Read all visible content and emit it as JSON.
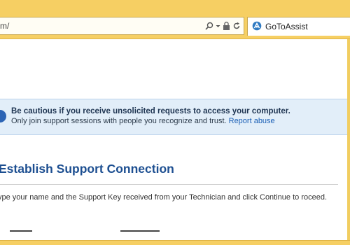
{
  "browser": {
    "address_text": "m/",
    "tab_title": "GoToAssist",
    "colors": {
      "chrome": "#f6cf63",
      "accent": "#1d4f91",
      "link": "#1b5fb5"
    },
    "icons": [
      "search-icon",
      "dropdown-arrow-icon",
      "lock-icon",
      "refresh-icon",
      "gotoassist-logo-icon"
    ]
  },
  "warning": {
    "title": "Be cautious if you receive unsolicited requests to access your computer.",
    "body": "Only join support sessions with people you recognize and trust.",
    "link_label": "Report abuse",
    "icon": "info-icon"
  },
  "main": {
    "heading": "Establish Support Connection",
    "instructions": "ype your name and the Support Key received from your Technician and click Continue to roceed."
  }
}
